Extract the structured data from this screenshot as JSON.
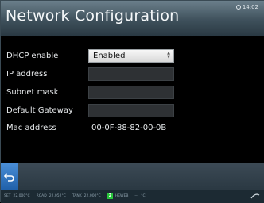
{
  "header": {
    "title": "Network Configuration",
    "clock": "14:02"
  },
  "form": {
    "dhcp": {
      "label": "DHCP enable",
      "value": "Enabled"
    },
    "ip": {
      "label": "IP address",
      "value": ""
    },
    "subnet": {
      "label": "Subnet mask",
      "value": ""
    },
    "gateway": {
      "label": "Default Gateway",
      "value": ""
    },
    "mac": {
      "label": "Mac address",
      "value": "00-0F-88-82-00-0B"
    }
  },
  "footer": {
    "back_icon": "back-arrow-icon"
  },
  "status": {
    "s1_label": "SET",
    "s1_value": "22.000°C",
    "s2_label": "ROAD",
    "s2_value": "22.052°C",
    "s3_label": "TANK",
    "s3_value": "22.000°C",
    "badge": "2",
    "s4_label": "HEWEB",
    "s5_label": "---",
    "s5_value": "°C"
  }
}
